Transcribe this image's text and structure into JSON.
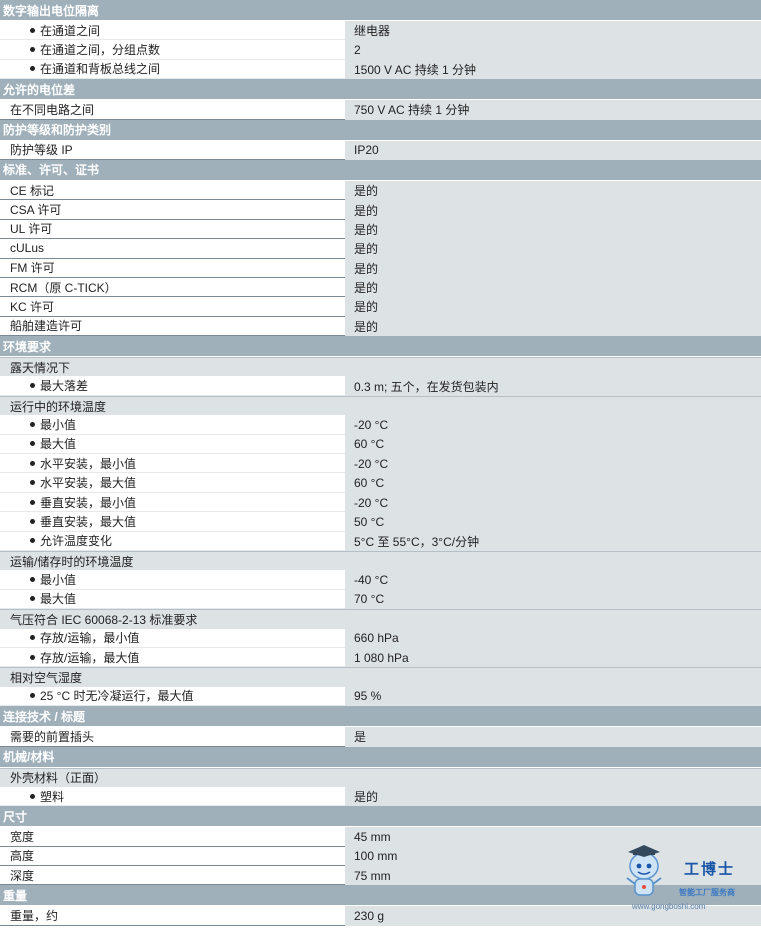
{
  "rows": [
    {
      "t": "section",
      "l": "数字输出电位隔离"
    },
    {
      "t": "b",
      "l": "在通道之间",
      "r": "继电器"
    },
    {
      "t": "b",
      "l": "在通道之间，分组点数",
      "r": "2"
    },
    {
      "t": "b",
      "l": "在通道和背板总线之间",
      "r": "1500 V AC 持续 1 分钟"
    },
    {
      "t": "section",
      "l": "允许的电位差"
    },
    {
      "t": "p",
      "l": "在不同电路之间",
      "r": "750 V AC 持续 1 分钟"
    },
    {
      "t": "section",
      "l": "防护等级和防护类别"
    },
    {
      "t": "p",
      "l": "防护等级 IP",
      "r": "IP20"
    },
    {
      "t": "section",
      "l": "标准、许可、证书"
    },
    {
      "t": "p",
      "l": "CE 标记",
      "r": "是的"
    },
    {
      "t": "p",
      "l": "CSA 许可",
      "r": "是的"
    },
    {
      "t": "p",
      "l": "UL 许可",
      "r": "是的"
    },
    {
      "t": "p",
      "l": "cULus",
      "r": "是的"
    },
    {
      "t": "p",
      "l": "FM 许可",
      "r": "是的"
    },
    {
      "t": "p",
      "l": "RCM（原 C-TICK）",
      "r": "是的"
    },
    {
      "t": "p",
      "l": "KC 许可",
      "r": "是的"
    },
    {
      "t": "p",
      "l": "船舶建造许可",
      "r": "是的"
    },
    {
      "t": "section",
      "l": "环境要求"
    },
    {
      "t": "sub",
      "l": "露天情况下",
      "r": ""
    },
    {
      "t": "b",
      "l": "最大落差",
      "r": "0.3 m; 五个，在发货包装内"
    },
    {
      "t": "sub",
      "l": "运行中的环境温度",
      "r": ""
    },
    {
      "t": "b",
      "l": "最小值",
      "r": "-20 °C"
    },
    {
      "t": "b",
      "l": "最大值",
      "r": "60 °C"
    },
    {
      "t": "b",
      "l": "水平安装，最小值",
      "r": "-20 °C"
    },
    {
      "t": "b",
      "l": "水平安装，最大值",
      "r": "60 °C"
    },
    {
      "t": "b",
      "l": "垂直安装，最小值",
      "r": "-20 °C"
    },
    {
      "t": "b",
      "l": "垂直安装，最大值",
      "r": "50 °C"
    },
    {
      "t": "b",
      "l": "允许温度变化",
      "r": "5°C 至 55°C，3°C/分钟"
    },
    {
      "t": "sub",
      "l": "运输/储存时的环境温度",
      "r": ""
    },
    {
      "t": "b",
      "l": "最小值",
      "r": "-40 °C"
    },
    {
      "t": "b",
      "l": "最大值",
      "r": "70 °C"
    },
    {
      "t": "sub",
      "l": "气压符合 IEC 60068-2-13 标准要求",
      "r": ""
    },
    {
      "t": "b",
      "l": "存放/运输，最小值",
      "r": "660 hPa"
    },
    {
      "t": "b",
      "l": "存放/运输，最大值",
      "r": "1 080 hPa"
    },
    {
      "t": "sub",
      "l": "相对空气湿度",
      "r": ""
    },
    {
      "t": "b",
      "l": "25 °C 时无冷凝运行，最大值",
      "r": "95 %"
    },
    {
      "t": "section",
      "l": "连接技术 / 标题"
    },
    {
      "t": "p",
      "l": "需要的前置插头",
      "r": "是"
    },
    {
      "t": "section",
      "l": "机械/材料"
    },
    {
      "t": "sub",
      "l": "外壳材料（正面）",
      "r": ""
    },
    {
      "t": "b",
      "l": "塑料",
      "r": "是的"
    },
    {
      "t": "section",
      "l": "尺寸"
    },
    {
      "t": "p",
      "l": "宽度",
      "r": "45 mm"
    },
    {
      "t": "p",
      "l": "高度",
      "r": "100 mm"
    },
    {
      "t": "p",
      "l": "深度",
      "r": "75 mm"
    },
    {
      "t": "section",
      "l": "重量"
    },
    {
      "t": "p",
      "l": "重量，约",
      "r": "230 g"
    }
  ],
  "watermark": {
    "title": "工博士",
    "tagline": "智能工厂服务商",
    "url": "www.gongboshi.com",
    "mascot": "robot-mascot-icon"
  }
}
